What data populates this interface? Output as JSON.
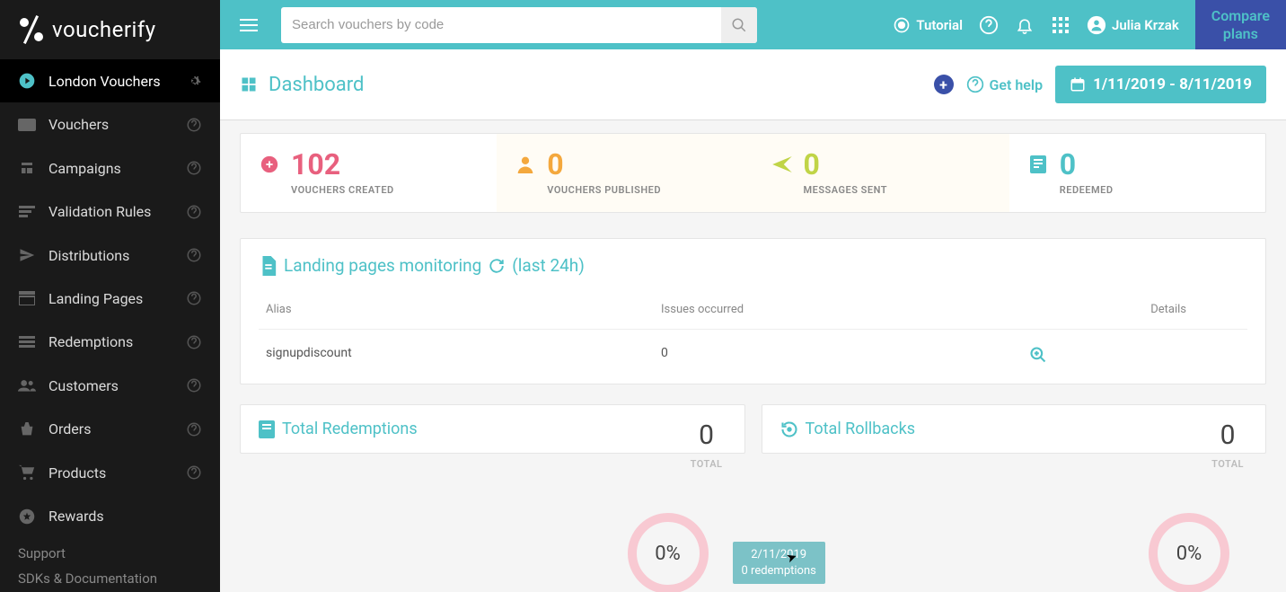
{
  "brand": "voucherify",
  "sidebar": {
    "items": [
      {
        "label": "London Vouchers",
        "icon": "play-circle"
      },
      {
        "label": "Vouchers",
        "icon": "ticket"
      },
      {
        "label": "Campaigns",
        "icon": "loyalty"
      },
      {
        "label": "Validation Rules",
        "icon": "rules"
      },
      {
        "label": "Distributions",
        "icon": "send"
      },
      {
        "label": "Landing Pages",
        "icon": "page"
      },
      {
        "label": "Redemptions",
        "icon": "list"
      },
      {
        "label": "Customers",
        "icon": "people"
      },
      {
        "label": "Orders",
        "icon": "basket"
      },
      {
        "label": "Products",
        "icon": "cart"
      },
      {
        "label": "Rewards",
        "icon": "star"
      }
    ],
    "support": "Support",
    "docs": "SDKs & Documentation"
  },
  "topbar": {
    "search_placeholder": "Search vouchers by code",
    "tutorial": "Tutorial",
    "user": "Julia Krzak",
    "compare_line1": "Compare",
    "compare_line2": "plans"
  },
  "subheader": {
    "title": "Dashboard",
    "get_help": "Get help",
    "date_range": "1/11/2019 - 8/11/2019"
  },
  "stats": [
    {
      "value": "102",
      "label": "VOUCHERS CREATED",
      "color": "#e8607e",
      "icon_color": "#e8607e",
      "icon": "plus-circle"
    },
    {
      "value": "0",
      "label": "VOUCHERS PUBLISHED",
      "color": "#f4a83d",
      "icon_color": "#f4a83d",
      "icon": "person",
      "highlight": true
    },
    {
      "value": "0",
      "label": "MESSAGES SENT",
      "color": "#c0d447",
      "icon_color": "#c0d447",
      "icon": "sent",
      "highlight": true
    },
    {
      "value": "0",
      "label": "REDEEMED",
      "color": "#4ec1c7",
      "icon_color": "#4ec1c7",
      "icon": "receipt"
    }
  ],
  "landing": {
    "title": "Landing pages monitoring",
    "suffix": "(last 24h)",
    "cols": {
      "alias": "Alias",
      "issues": "Issues occurred",
      "details": "Details"
    },
    "rows": [
      {
        "alias": "signupdiscount",
        "issues": "0"
      }
    ]
  },
  "cards": [
    {
      "title": "Total Redemptions",
      "total": "0",
      "total_label": "TOTAL",
      "pct": "0%"
    },
    {
      "title": "Total Rollbacks",
      "total": "0",
      "total_label": "TOTAL",
      "pct": "0%",
      "tooltip_line1": "2/11/2019",
      "tooltip_line2": "0 redemptions"
    }
  ]
}
